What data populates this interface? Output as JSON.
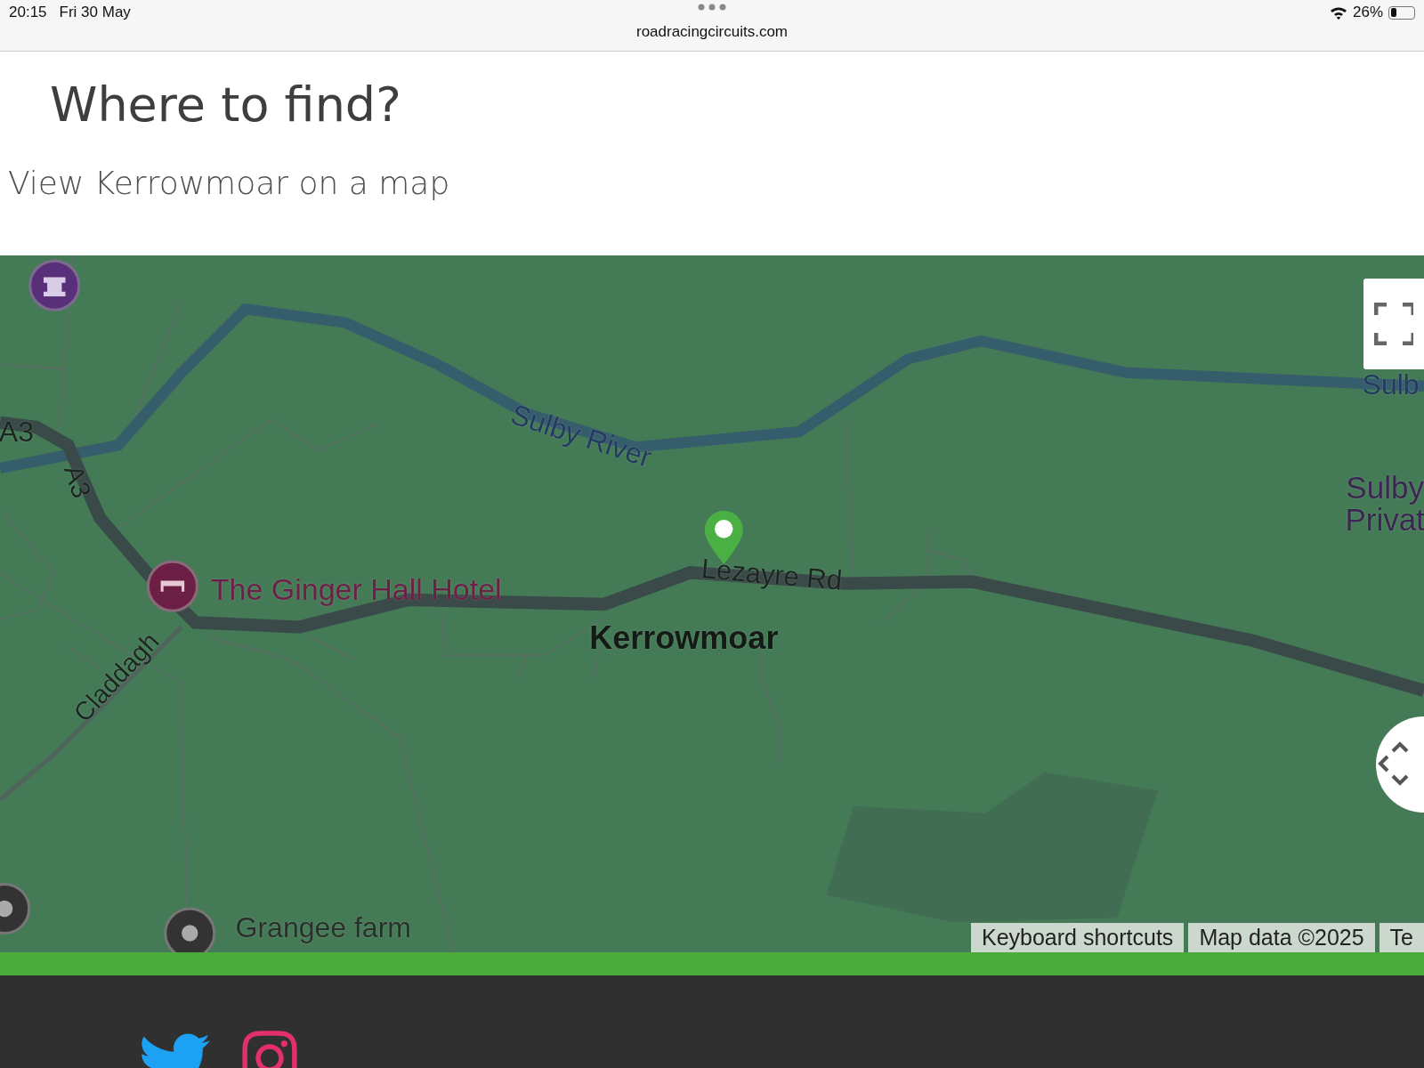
{
  "status_bar": {
    "time": "20:15",
    "date": "Fri 30 May",
    "url": "roadracingcircuits.com",
    "battery": "26%"
  },
  "page": {
    "heading": "Where to find?",
    "subtitle": "View Kerrowmoar on a map"
  },
  "map": {
    "labels": [
      {
        "kind": "road",
        "text": "A3"
      },
      {
        "kind": "road",
        "text": "A3"
      },
      {
        "kind": "water",
        "text": "Sulby River"
      },
      {
        "kind": "hotel",
        "text": "The Ginger Hall Hotel"
      },
      {
        "kind": "road",
        "text": "Lezayre Rd"
      },
      {
        "kind": "place",
        "text": "Kerrowmoar"
      },
      {
        "kind": "road",
        "text": "Claddagh"
      },
      {
        "kind": "poi",
        "text": "Grangee farm"
      },
      {
        "kind": "water",
        "text": "Sulb"
      },
      {
        "kind": "district",
        "text": "Sulby"
      },
      {
        "kind": "district",
        "text": "Privat"
      }
    ],
    "attribution": [
      "Keyboard shortcuts",
      "Map data ©2025",
      "Te"
    ]
  }
}
